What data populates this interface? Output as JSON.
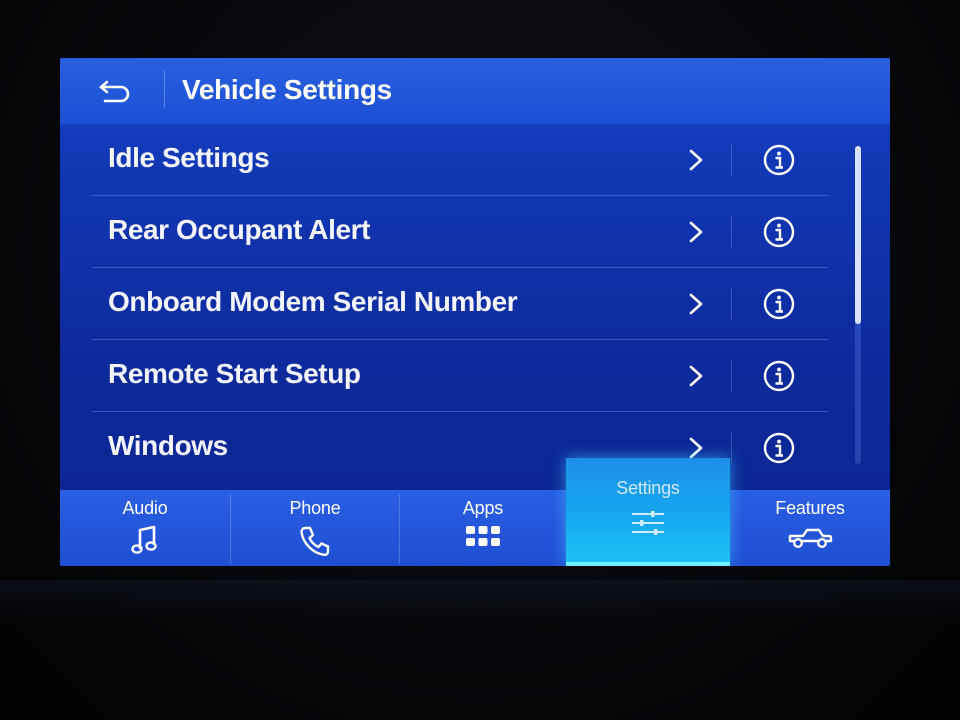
{
  "header": {
    "title": "Vehicle Settings",
    "back_icon": "back-arrow-icon"
  },
  "list": {
    "items": [
      {
        "label": "Idle Settings"
      },
      {
        "label": "Rear Occupant Alert"
      },
      {
        "label": "Onboard Modem Serial Number"
      },
      {
        "label": "Remote Start Setup"
      },
      {
        "label": "Windows"
      }
    ],
    "row_icons": [
      "chevron-right-icon",
      "info-icon"
    ]
  },
  "scrollbar": {
    "visible_fraction": 0.56,
    "position_fraction": 0.0
  },
  "tabs": [
    {
      "label": "Audio",
      "icon": "music-note-icon",
      "active": false
    },
    {
      "label": "Phone",
      "icon": "phone-icon",
      "active": false
    },
    {
      "label": "Apps",
      "icon": "apps-grid-icon",
      "active": false
    },
    {
      "label": "Settings",
      "icon": "sliders-icon",
      "active": true
    },
    {
      "label": "Features",
      "icon": "truck-icon",
      "active": false
    }
  ],
  "colors": {
    "screen_blue": "#1238b6",
    "header_blue": "#1d4fd4",
    "active_tab": "#15a8f0",
    "active_underline": "#6ff0ff",
    "text": "#ffffff"
  }
}
